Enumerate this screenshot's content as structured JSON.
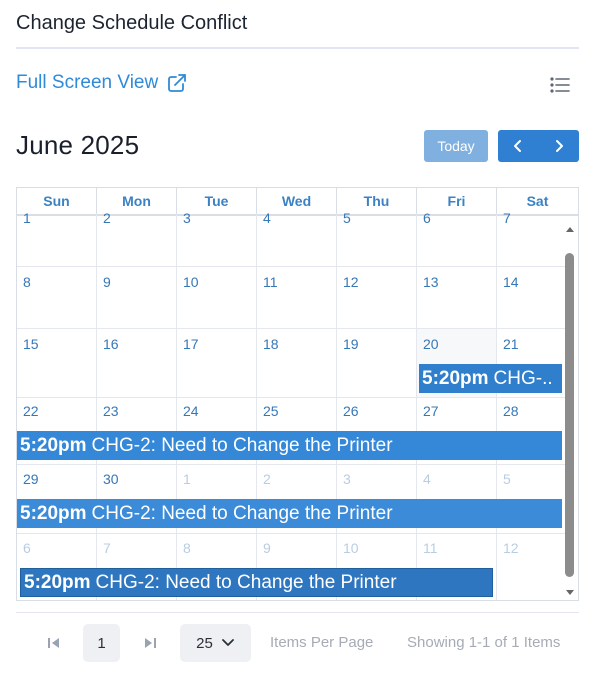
{
  "header": {
    "title": "Change Schedule Conflict"
  },
  "toolbar": {
    "full_screen_label": "Full Screen View"
  },
  "calendar": {
    "month_label": "June 2025",
    "today_label": "Today",
    "weekdays": [
      "Sun",
      "Mon",
      "Tue",
      "Wed",
      "Thu",
      "Fri",
      "Sat"
    ],
    "weeks": [
      [
        "1",
        "2",
        "3",
        "4",
        "5",
        "6",
        "7"
      ],
      [
        "8",
        "9",
        "10",
        "11",
        "12",
        "13",
        "14"
      ],
      [
        "15",
        "16",
        "17",
        "18",
        "19",
        "20",
        "21"
      ],
      [
        "22",
        "23",
        "24",
        "25",
        "26",
        "27",
        "28"
      ],
      [
        "29",
        "30",
        "1",
        "2",
        "3",
        "4",
        "5"
      ],
      [
        "6",
        "7",
        "8",
        "9",
        "10",
        "11",
        "12"
      ]
    ],
    "events": [
      {
        "time": "5:20pm",
        "title": "CHG-.."
      },
      {
        "time": "5:20pm",
        "title": "CHG-2: Need to Change the Printer"
      },
      {
        "time": "5:20pm",
        "title": "CHG-2: Need to Change the Printer"
      },
      {
        "time": "5:20pm",
        "title": "CHG-2: Need to Change the Printer"
      }
    ]
  },
  "pagination": {
    "page": "1",
    "per_page": "25",
    "per_page_label": "Items Per Page",
    "showing": "Showing 1-1 of 1 Items"
  }
}
